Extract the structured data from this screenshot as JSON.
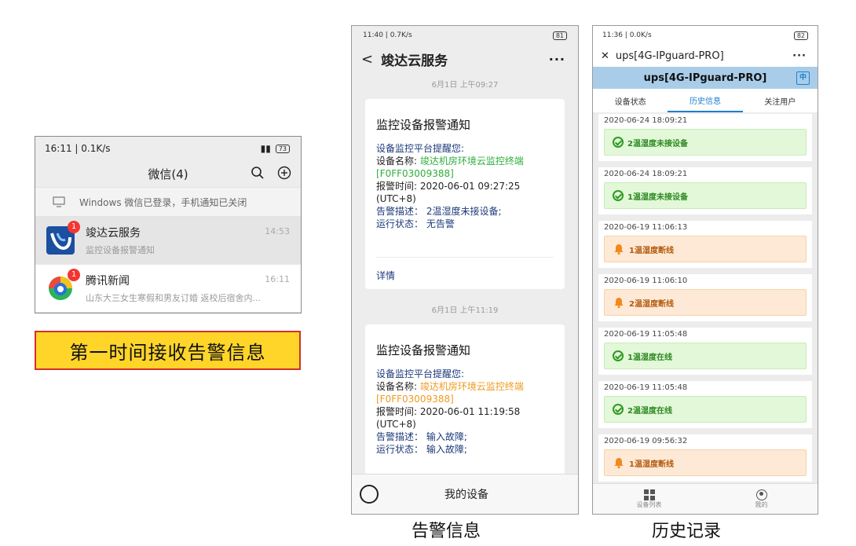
{
  "phone1": {
    "status_time": "16:11 | 0.1K/s",
    "battery": "73",
    "title": "微信(4)",
    "notice": "Windows 微信已登录，手机通知已关闭",
    "chats": [
      {
        "name": "竣达云服务",
        "message": "监控设备报警通知",
        "time": "14:53",
        "badge": "1"
      },
      {
        "name": "腾讯新闻",
        "message": "山东大三女生寒假和男友订婚 返校后宿舍内...",
        "time": "16:11",
        "badge": "1"
      }
    ]
  },
  "banner": "第一时间接收告警信息",
  "phone2": {
    "status_time": "11:40 | 0.7K/s",
    "battery": "81",
    "title": "竣达云服务",
    "more": "···",
    "messages": [
      {
        "timestamp": "6月1日 上午09:27",
        "title": "监控设备报警通知",
        "greeting": "设备监控平台提醒您:",
        "device_label": "设备名称: ",
        "device_name": "竣达机房环境云监控终端",
        "device_id": "[F0FF03009388]",
        "time_label": "报警时间: 2020-06-01 09:27:25",
        "tz": "(UTC+8)",
        "desc": "告警描述： 2温湿度未接设备;",
        "state": "运行状态： 无告警",
        "detail": "详情"
      },
      {
        "timestamp": "6月1日 上午11:19",
        "title": "监控设备报警通知",
        "greeting": "设备监控平台提醒您:",
        "device_label": "设备名称: ",
        "device_name": "竣达机房环境云监控终端",
        "device_id": "[F0FF03009388]",
        "time_label": "报警时间: 2020-06-01 11:19:58",
        "tz": "(UTC+8)",
        "desc": "告警描述： 输入故障;",
        "state": "运行状态： 输入故障;"
      }
    ],
    "bottom_menu": "我的设备"
  },
  "phone3": {
    "status_time": "11:36 | 0.0K/s",
    "battery": "82",
    "title": "ups[4G-IPguard-PRO]",
    "more": "···",
    "bar_title": "ups[4G-IPguard-PRO]",
    "lang": "中",
    "tabs": [
      "设备状态",
      "历史信息",
      "关注用户"
    ],
    "records": [
      {
        "date": "2020-06-24 18:09:21",
        "text": "2温湿度未接设备",
        "kind": "ok"
      },
      {
        "date": "2020-06-24 18:09:21",
        "text": "1温湿度未接设备",
        "kind": "ok"
      },
      {
        "date": "2020-06-19 11:06:13",
        "text": "1温湿度断线",
        "kind": "alarm"
      },
      {
        "date": "2020-06-19 11:06:10",
        "text": "2温湿度断线",
        "kind": "alarm"
      },
      {
        "date": "2020-06-19 11:05:48",
        "text": "1温湿度在线",
        "kind": "ok"
      },
      {
        "date": "2020-06-19 11:05:48",
        "text": "2温湿度在线",
        "kind": "ok"
      },
      {
        "date": "2020-06-19 09:56:32",
        "text": "1温湿度断线",
        "kind": "alarm"
      }
    ],
    "nav": [
      "设备列表",
      "我的"
    ]
  },
  "captions": {
    "left": "告警信息",
    "right": "历史记录"
  }
}
